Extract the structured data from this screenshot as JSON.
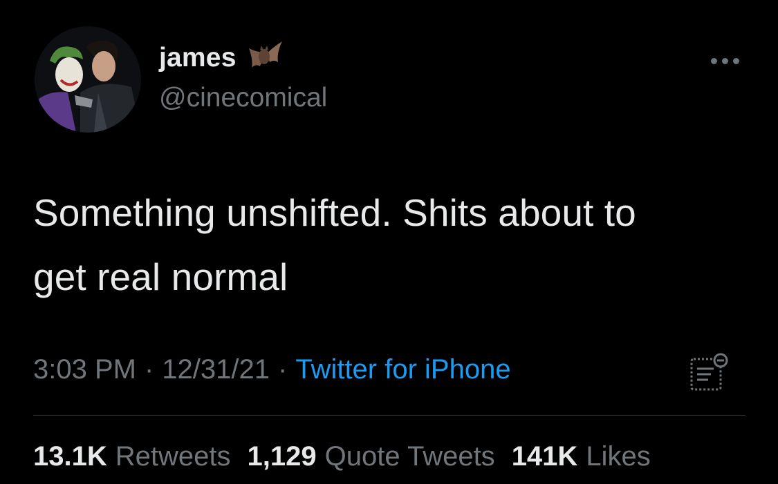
{
  "tweet": {
    "author": {
      "display_name": "james",
      "display_name_emoji": "bat-icon",
      "handle": "@cinecomical"
    },
    "text_lines": [
      "Something unshifted. Shits about to",
      "get real normal"
    ],
    "meta": {
      "time": "3:03 PM",
      "separator": "·",
      "date": "12/31/21",
      "source": "Twitter for iPhone"
    },
    "stats": {
      "retweets": {
        "count": "13.1K",
        "label": "Retweets"
      },
      "quote_tweets": {
        "count": "1,129",
        "label": "Quote Tweets"
      },
      "likes": {
        "count": "141K",
        "label": "Likes"
      }
    },
    "icons": {
      "more": "more-options-icon",
      "analytics": "analytics-icon",
      "avatar": "avatar"
    },
    "colors": {
      "background": "#000000",
      "primary_text": "#e7e9ea",
      "secondary_text": "#71767b",
      "link": "#1d9bf0",
      "divider": "#2f3336"
    }
  }
}
